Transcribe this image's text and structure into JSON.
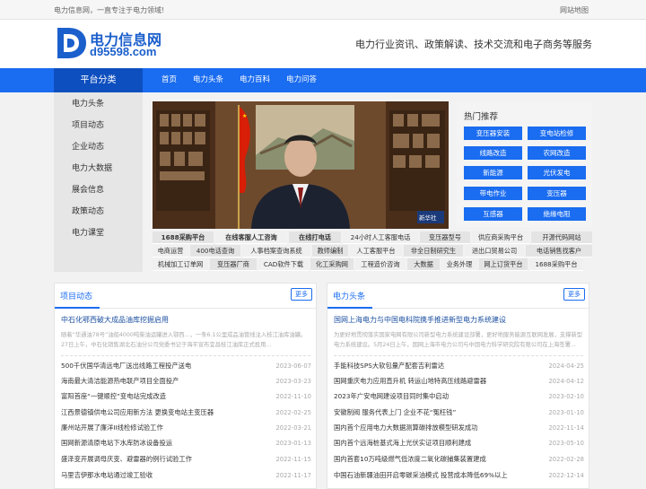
{
  "topbar": {
    "left": "电力信息网，一直专注于电力领域!",
    "right": "网站地图"
  },
  "header": {
    "logo_cn": "电力信息网",
    "logo_url": "d95598.com",
    "slogan": "电力行业资讯、政策解读、技术交流和电子商务等服务"
  },
  "nav": {
    "category": "平台分类",
    "items": [
      "首页",
      "电力头条",
      "电力百科",
      "电力问答"
    ]
  },
  "sidebar": [
    "电力头条",
    "项目动态",
    "企业动态",
    "电力大数据",
    "展会信息",
    "政策动态",
    "电力课堂"
  ],
  "hot": {
    "title": "热门推荐",
    "buttons": [
      "变压器安装",
      "变电站检修",
      "线路改造",
      "农网改造",
      "新能源",
      "光伏发电",
      "带电作业",
      "变压器",
      "互感器",
      "绝缘电阻"
    ]
  },
  "tags": [
    [
      "1688采购平台",
      "在线客服人工咨询",
      "在线打电话",
      "24小时人工客服电话",
      "变压器型号",
      "供应商采购平台",
      "开源代码网站"
    ],
    [
      "电商运营",
      "400电话查询",
      "人事档案查询系统",
      "教师编制",
      "人工客服平台",
      "非全日制研究生",
      "进出口贸易公司",
      "电话销售找客户"
    ],
    [
      "机械加工订单网",
      "变压器厂商",
      "CAD软件下载",
      "化工采购网",
      "工程造价咨询",
      "大数据",
      "业务外理",
      "网上订货平台",
      "1688采购平台"
    ]
  ],
  "left_panel": {
    "title": "项目动态",
    "more": "更多",
    "lead_title": "中石化鄂西破大成品油库挖掘启用",
    "lead_desc": "随着“华通油78号”油船4000吨柴油运罐进入鄂西...，一条6.1公里成品油管线注入枝江油库油罐。27日上午，中石化销售湖北石油分公司党委书记于海平宣布宜昌枝江油库正式投用...",
    "rows": [
      {
        "t": "500千伏国华清远电厂送出线路工程投产送电",
        "d": "2023-06-07"
      },
      {
        "t": "海南最大清洁能源热电联产项目全面投产",
        "d": "2023-03-23"
      },
      {
        "t": "富阳首座“一键顺控”变电站完成改造",
        "d": "2022-11-10"
      },
      {
        "t": "江西景德镇供电公司应用新方法 更换变电站主变压器",
        "d": "2022-02-25"
      },
      {
        "t": "廉州站开展了廉洋II线检修试验工作",
        "d": "2022-03-21"
      },
      {
        "t": "国网新源清原电站下水库防冰设备投运",
        "d": "2023-01-13"
      },
      {
        "t": "盛泽变开展调母庆变、避雷器的例行试验工作",
        "d": "2022-11-15"
      },
      {
        "t": "马里吉伊那水电站通过竣工验收",
        "d": "2022-11-17"
      }
    ]
  },
  "right_panel": {
    "title": "电力头条",
    "more": "更多",
    "lead_title": "国网上海电力与中国电科院携手推进新型电力系统建设",
    "lead_desc": "为更好地贯彻落实国家电网有限公司新型电力系统建设部署，更好地服务能源互联网发展，支撑新型电力系统建设。5月24日上午，国网上海市电力公司与中国电力科学研究院有限公司在上海签署...",
    "rows": [
      {
        "t": "手能科技SPS大软包量产配套吉利雷达",
        "d": "2024-04-25"
      },
      {
        "t": "国网重庆电力应用直升机 转运山地特高压线路避雷器",
        "d": "2024-04-12"
      },
      {
        "t": "2023年广安电网建设项目同时集中启动",
        "d": "2023-02-10"
      },
      {
        "t": "安徽制阀 服务代表上门 企业不花“冤枉钱”",
        "d": "2023-01-10"
      },
      {
        "t": "国内首个应用电力大数据测算碳排放模型研发成功",
        "d": "2022-11-14"
      },
      {
        "t": "国内首个远海桩基式海上光伏实证项目顺利建成",
        "d": "2023-05-10"
      },
      {
        "t": "国内首套10万吨级燃气低浓度二氧化碳捕集装置建成",
        "d": "2022-02-28"
      },
      {
        "t": "中国石油新疆油田开启零碳采油模式 投营成本降低69%以上",
        "d": "2022-12-14"
      }
    ]
  },
  "banner": {
    "caption": "新华社",
    "colors": {
      "flag": "#d81e06",
      "wall": "#5b3b22",
      "suit": "#1c2230"
    }
  }
}
